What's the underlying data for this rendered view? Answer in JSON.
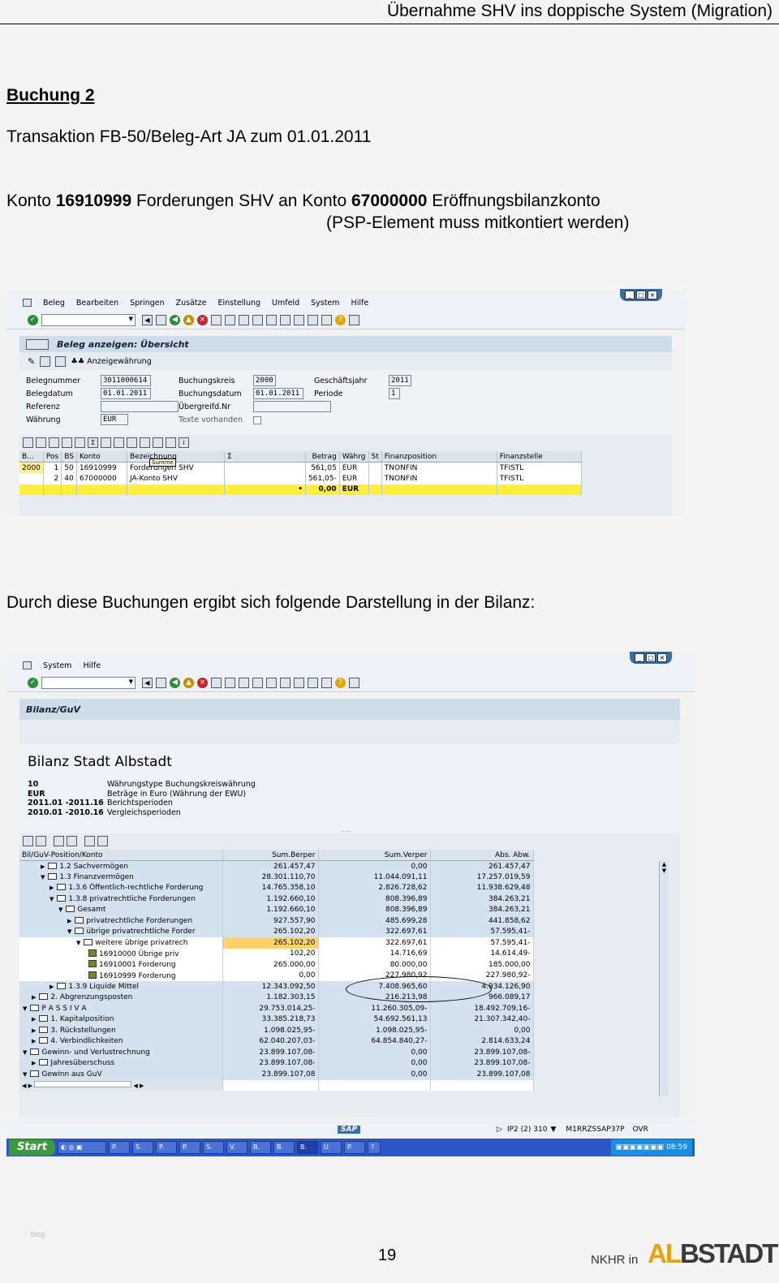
{
  "header": {
    "title": "Übernahme SHV ins doppische System (Migration)"
  },
  "doc": {
    "heading": "Buchung 2",
    "transaction": "Transaktion FB-50/Beleg-Art JA zum 01.01.2011",
    "line1_a": "Konto ",
    "line1_b": "16910999",
    "line1_c": " Forderungen SHV an Konto ",
    "line1_d": "67000000",
    "line1_e": " Eröffnungsbilanzkonto",
    "line2": "(PSP-Element muss mitkontiert werden)",
    "bilanz_intro": "Durch diese Buchungen ergibt sich folgende Darstellung in der Bilanz:"
  },
  "screen1": {
    "menu": [
      "Beleg",
      "Bearbeiten",
      "Springen",
      "Zusätze",
      "Einstellung",
      "Umfeld",
      "System",
      "Hilfe"
    ],
    "title": "Beleg anzeigen: Übersicht",
    "app_toolbar_label": "Anzeigewährung",
    "fields": {
      "belegnummer_label": "Belegnummer",
      "belegnummer": "3011000614",
      "buchungskreis_label": "Buchungskreis",
      "buchungskreis": "2000",
      "geschaeftsjahr_label": "Geschäftsjahr",
      "geschaeftsjahr": "2011",
      "belegdatum_label": "Belegdatum",
      "belegdatum": "01.01.2011",
      "buchungsdatum_label": "Buchungsdatum",
      "buchungsdatum": "01.01.2011",
      "periode_label": "Periode",
      "periode": "1",
      "referenz_label": "Referenz",
      "uebergreifd_label": "Übergreifd.Nr",
      "waehrung_label": "Währung",
      "waehrung": "EUR",
      "texte_label": "Texte vorhanden"
    },
    "tooltip": "Summe",
    "columns": [
      "B...",
      "Pos",
      "BS",
      "Konto",
      "Bezeichnung",
      "Σ",
      "Betrag",
      "Währg",
      "St",
      "Finanzposition",
      "Finanzstelle"
    ],
    "rows": [
      [
        "2000",
        "1",
        "50",
        "16910999",
        "Forderungen SHV",
        "",
        "561,05",
        "EUR",
        "",
        "TNONFIN",
        "TFISTL"
      ],
      [
        "",
        "2",
        "40",
        "67000000",
        "JA-Konto SHV",
        "",
        "561,05-",
        "EUR",
        "",
        "TNONFIN",
        "TFISTL"
      ]
    ],
    "sum_marker": "•",
    "sum": "0,00",
    "sum_cur": "EUR"
  },
  "screen2": {
    "menu": [
      "System",
      "Hilfe"
    ],
    "title": "Bilanz/GuV",
    "report_title": "Bilanz Stadt Albstadt",
    "info": [
      {
        "k": "10",
        "v": "Währungstype Buchungskreiswährung"
      },
      {
        "k": "EUR",
        "v": "Beträge in Euro (Währung der EWU)"
      },
      {
        "k": "2011.01 -2011.16",
        "v": "Berichtsperioden"
      },
      {
        "k": "2010.01 -2010.16",
        "v": "Vergleichsperioden"
      }
    ],
    "columns": [
      "Bil/GuV-Position/Konto",
      "Sum.Berper",
      "Sum.Verper",
      "Abs. Abw."
    ],
    "rows": [
      {
        "label": "1.2 Sachvermögen",
        "a": "261.457,47",
        "b": "0,00",
        "c": "261.457,47",
        "lvl": 3,
        "style": "blue"
      },
      {
        "label": "1.3 Finanzvermögen",
        "a": "28.301.110,70",
        "b": "11.044.091,11",
        "c": "17.257.019,59",
        "lvl": 3,
        "style": "blue",
        "open": true
      },
      {
        "label": "1.3.6 Öffentlich-rechtliche Forderung",
        "a": "14.765.358,10",
        "b": "2.826.728,62",
        "c": "11.938.629,48",
        "lvl": 4,
        "style": "blue"
      },
      {
        "label": "1.3.8 privatrechtliche Forderungen",
        "a": "1.192.660,10",
        "b": "808.396,89",
        "c": "384.263,21",
        "lvl": 4,
        "style": "blue",
        "open": true
      },
      {
        "label": "Gesamt",
        "a": "1.192.660,10",
        "b": "808.396,89",
        "c": "384.263,21",
        "lvl": 5,
        "style": "blue",
        "open": true
      },
      {
        "label": "privatrechtliche Forderungen",
        "a": "927.557,90",
        "b": "485.699,28",
        "c": "441.858,62",
        "lvl": 6,
        "style": "blue"
      },
      {
        "label": "übrige privatrechtliche Forder",
        "a": "265.102,20",
        "b": "322.697,61",
        "c": "57.595,41-",
        "lvl": 6,
        "style": "blue",
        "open": true
      },
      {
        "label": "weitere übrige privatrech",
        "a": "265.102,20",
        "b": "322.697,61",
        "c": "57.595,41-",
        "lvl": 7,
        "style": "hl",
        "open": true,
        "sel": true
      },
      {
        "label": "16910000 Übrige priv",
        "a": "102,20",
        "b": "14.716,69",
        "c": "14.614,49-",
        "lvl": 8,
        "style": "hl",
        "acct": true
      },
      {
        "label": "16910001 Forderung",
        "a": "265.000,00",
        "b": "80.000,00",
        "c": "185.000,00",
        "lvl": 8,
        "style": "hl",
        "acct": true
      },
      {
        "label": "16910999 Forderung",
        "a": "0,00",
        "b": "227.980,92",
        "c": "227.980,92-",
        "lvl": 8,
        "style": "hl",
        "acct": true
      },
      {
        "label": "1.3.9 Liquide Mittel",
        "a": "12.343.092,50",
        "b": "7.408.965,60",
        "c": "4.934.126,90",
        "lvl": 4,
        "style": "blue"
      },
      {
        "label": "2. Abgrenzungsposten",
        "a": "1.182.303,15",
        "b": "216.213,98",
        "c": "966.089,17",
        "lvl": 2,
        "style": "blue"
      },
      {
        "label": "P A S S I V A",
        "a": "29.753.014,25-",
        "b": "11.260.305,09-",
        "c": "18.492.709,16-",
        "lvl": 1,
        "style": "blue",
        "open": true
      },
      {
        "label": "1. Kapitalposition",
        "a": "33.385.218,73",
        "b": "54.692.561,13",
        "c": "21.307.342,40-",
        "lvl": 2,
        "style": "blue"
      },
      {
        "label": "3. Rückstellungen",
        "a": "1.098.025,95-",
        "b": "1.098.025,95-",
        "c": "0,00",
        "lvl": 2,
        "style": "blue"
      },
      {
        "label": "4. Verbindlichkeiten",
        "a": "62.040.207,03-",
        "b": "64.854.840,27-",
        "c": "2.814.633,24",
        "lvl": 2,
        "style": "blue"
      },
      {
        "label": "Gewinn- und Verlustrechnung",
        "a": "23.899.107,08-",
        "b": "0,00",
        "c": "23.899.107,08-",
        "lvl": 1,
        "style": "blue",
        "open": true
      },
      {
        "label": "Jahresüberschuss",
        "a": "23.899.107,08-",
        "b": "0,00",
        "c": "23.899.107,08-",
        "lvl": 2,
        "style": "blue"
      },
      {
        "label": "Gewinn aus GuV",
        "a": "23.899.107,08",
        "b": "0,00",
        "c": "23.899.107,08",
        "lvl": 1,
        "style": "blue",
        "open": true
      }
    ],
    "status": {
      "sap": "SAP",
      "system": "IP2 (2) 310",
      "host": "M1RRZSSAP37P",
      "mode": "OVR"
    }
  },
  "taskbar": {
    "start": "Start",
    "buttons": [
      "P.",
      "S.",
      "P.",
      "P.",
      "S.",
      "V.",
      "B.",
      "B.",
      "B.",
      "U.",
      "P."
    ],
    "clock": "08:59"
  },
  "footer": {
    "page": "19",
    "brand_prefix": "NKHR in",
    "brand_logo": "ALBSTADT",
    "watermark": "blog"
  }
}
